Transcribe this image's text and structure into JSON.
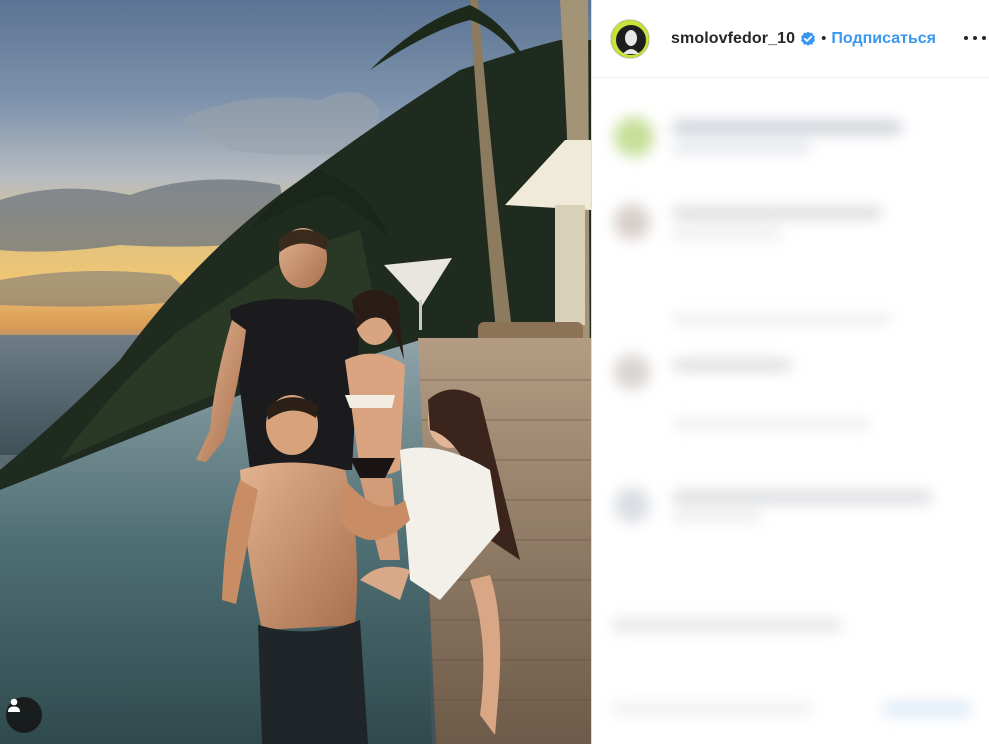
{
  "post": {
    "username": "smolovfedor_10",
    "verified": true,
    "separator": "•",
    "follow_label": "Подписаться",
    "more_icon": "more-horizontal-icon",
    "tag_icon": "user-tag-icon"
  },
  "colors": {
    "follow": "#3897f0",
    "verified_badge": "#3897f0",
    "username": "#262626",
    "avatar_ring": "#c7e23a"
  }
}
